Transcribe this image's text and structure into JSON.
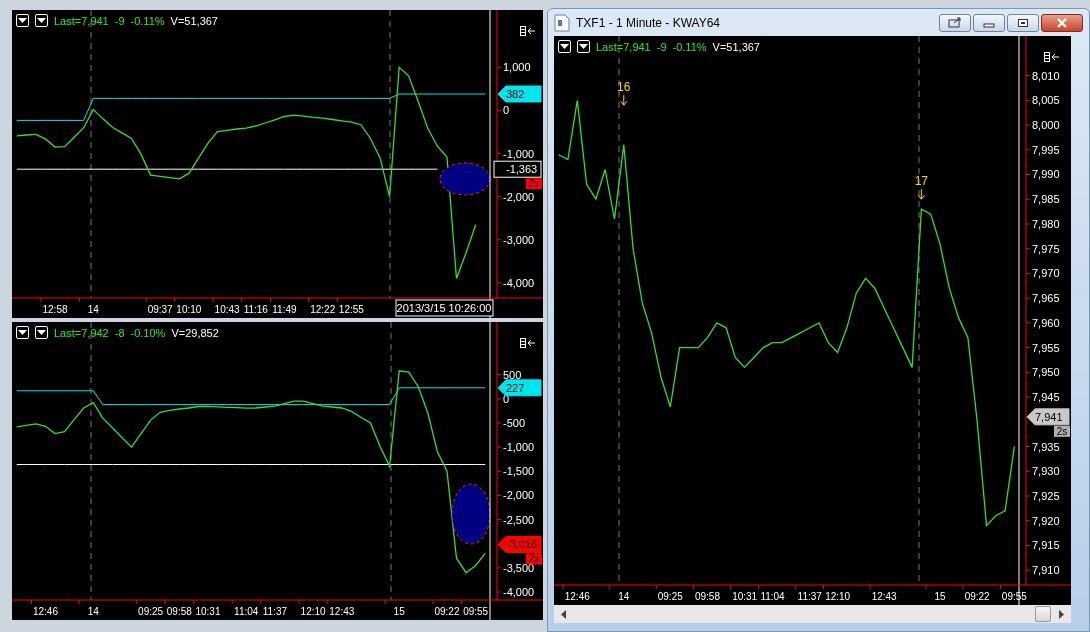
{
  "charts": [
    {
      "quote": {
        "last": "Last=7,941",
        "change": "-9",
        "percent": "-0.11%",
        "volume": "V=51,367"
      },
      "highlight": true,
      "chart_data": {
        "type": "line",
        "ylim": [
          -4350,
          2330
        ],
        "categories": [
          null,
          null,
          null,
          null,
          "12:58",
          null,
          null,
          null,
          "14",
          null,
          null,
          null,
          null,
          null,
          null,
          "09:37",
          null,
          null,
          "10:10",
          null,
          null,
          null,
          "10:43",
          null,
          null,
          "11:16",
          null,
          null,
          "11:49",
          null,
          null,
          null,
          "12:22",
          null,
          null,
          "12:55",
          null,
          null,
          null,
          null,
          null,
          null,
          null,
          null,
          null,
          null,
          null,
          null,
          null,
          null
        ],
        "yticks": [
          {
            "value": 1000,
            "label": "1,000"
          },
          0,
          {
            "value": -1000,
            "label": "-1,000"
          },
          {
            "value": -2000,
            "label": "-2,000"
          },
          {
            "value": -3000,
            "label": "-3,000"
          },
          {
            "value": -4000,
            "label": "-4,000"
          }
        ],
        "series": [
          {
            "color": "#00e5ee",
            "values": [
              -230,
              -230,
              -230,
              -230,
              -230,
              -230,
              -230,
              -230,
              280,
              280,
              280,
              280,
              280,
              280,
              280,
              280,
              280,
              280,
              280,
              280,
              280,
              280,
              280,
              280,
              280,
              280,
              280,
              280,
              280,
              280,
              280,
              280,
              280,
              280,
              280,
              280,
              280,
              280,
              280,
              280,
              382,
              382,
              382,
              382,
              382,
              382,
              382,
              382,
              382,
              382
            ]
          },
          {
            "color": "#ffffff",
            "values": [
              -1363,
              -1363,
              -1363,
              -1363,
              -1363,
              -1363,
              -1363,
              -1363,
              -1363,
              -1363,
              -1363,
              -1363,
              -1363,
              -1363,
              -1363,
              -1363,
              -1363,
              -1363,
              -1363,
              -1363,
              -1363,
              -1363,
              -1363,
              -1363,
              -1363,
              -1363,
              -1363,
              -1363,
              -1363,
              -1363,
              -1363,
              -1363,
              -1363,
              -1363,
              -1363,
              -1363,
              -1363,
              -1363,
              -1363,
              -1363,
              -1363,
              -1363,
              -1363,
              -1363,
              -1363,
              null,
              null,
              null,
              null,
              null
            ]
          },
          {
            "color": "#33dd33",
            "values": [
              -590,
              -570,
              -555,
              -660,
              -850,
              -840,
              -620,
              -400,
              20,
              -190,
              -390,
              -520,
              -650,
              -1020,
              -1500,
              -1530,
              -1560,
              -1585,
              -1460,
              -1110,
              -760,
              -490,
              -460,
              -430,
              -410,
              -360,
              -290,
              -220,
              -140,
              -110,
              -130,
              -160,
              -180,
              -210,
              -240,
              -270,
              -330,
              -650,
              -1100,
              -2000,
              1000,
              800,
              200,
              -420,
              -830,
              -1080,
              -3900,
              -3300,
              -2650,
              null
            ]
          }
        ]
      },
      "tags": [
        {
          "kind": "cyan",
          "text": "382"
        },
        {
          "kind": "boxed",
          "text": "-1,363",
          "badge": "2s"
        }
      ],
      "crosshair_time": "2013/3/15 10:26:00"
    },
    {
      "quote": {
        "last": "Last=7,942",
        "change": "-8",
        "percent": "-0.10%",
        "volume": "V=29,852"
      },
      "highlight": true,
      "chart_data": {
        "type": "line",
        "ylim": [
          -4165,
          1590
        ],
        "categories": [
          null,
          null,
          null,
          "12:46",
          null,
          null,
          null,
          null,
          "14",
          null,
          null,
          null,
          null,
          null,
          "09:25",
          null,
          null,
          "09:58",
          null,
          null,
          "10:31",
          null,
          null,
          null,
          "11:04",
          null,
          null,
          "11:37",
          null,
          null,
          null,
          "12:10",
          null,
          null,
          "12:43",
          null,
          null,
          null,
          null,
          null,
          "15",
          null,
          null,
          null,
          null,
          "09:22",
          null,
          null,
          "09:55",
          null
        ],
        "yticks": [
          500,
          0,
          -500,
          {
            "value": -1000,
            "label": "-1,000"
          },
          {
            "value": -1500,
            "label": "-1,500"
          },
          {
            "value": -2000,
            "label": "-2,000"
          },
          {
            "value": -2500,
            "label": "-2,500"
          },
          {
            "value": -3500,
            "label": "-3,500"
          },
          {
            "value": -4000,
            "label": "-4,000"
          }
        ],
        "series": [
          {
            "color": "#00e5ee",
            "values": [
              165,
              165,
              165,
              165,
              165,
              165,
              165,
              165,
              165,
              -120,
              -120,
              -120,
              -120,
              -120,
              -120,
              -120,
              -120,
              -120,
              -120,
              -120,
              -120,
              -120,
              -120,
              -120,
              -120,
              -120,
              -120,
              -120,
              -120,
              -120,
              -120,
              -120,
              -120,
              -120,
              -120,
              -120,
              -120,
              -120,
              -120,
              -120,
              227,
              227,
              227,
              227,
              227,
              227,
              227,
              227,
              227,
              227
            ]
          },
          {
            "color": "#ffffff",
            "values": [
              -1360,
              -1360,
              -1360,
              -1360,
              -1360,
              -1360,
              -1360,
              -1360,
              -1360,
              -1360,
              -1360,
              -1360,
              -1360,
              -1360,
              -1360,
              -1360,
              -1360,
              -1360,
              -1360,
              -1360,
              -1360,
              -1360,
              -1360,
              -1360,
              -1360,
              -1360,
              -1360,
              -1360,
              -1360,
              -1360,
              -1360,
              -1360,
              -1360,
              -1360,
              -1360,
              -1360,
              -1360,
              -1360,
              -1360,
              -1360,
              -1360,
              -1360,
              -1360,
              -1360,
              -1360,
              -1360,
              -1360,
              -1360,
              -1360,
              -1360
            ]
          },
          {
            "color": "#33dd33",
            "values": [
              -580,
              -550,
              -520,
              -570,
              -720,
              -680,
              -430,
              -190,
              -80,
              -400,
              -600,
              -800,
              -1000,
              -720,
              -440,
              -280,
              -240,
              -210,
              -190,
              -160,
              -155,
              -165,
              -175,
              -185,
              -195,
              -190,
              -170,
              -150,
              -100,
              -50,
              -50,
              -100,
              -150,
              -170,
              -190,
              -260,
              -380,
              -500,
              -990,
              -1400,
              580,
              550,
              250,
              -300,
              -1100,
              -1500,
              -3300,
              -3600,
              -3450,
              -3200
            ]
          }
        ]
      },
      "tags": [
        {
          "kind": "cyan",
          "text": "227"
        },
        {
          "kind": "red",
          "text": "-3,016",
          "badge": "2s"
        }
      ]
    },
    {
      "quote": {
        "last": "Last=7,941",
        "change": "-9",
        "percent": "-0.11%",
        "volume": "V=51,367"
      },
      "chart_data": {
        "type": "line",
        "ylim": [
          7907,
          8018
        ],
        "categories": [
          null,
          null,
          "12:46",
          null,
          null,
          null,
          null,
          "14",
          null,
          null,
          null,
          null,
          "09:25",
          null,
          null,
          null,
          "09:58",
          null,
          null,
          null,
          "10:31",
          null,
          null,
          "11:04",
          null,
          null,
          null,
          "11:37",
          null,
          null,
          "12:10",
          null,
          null,
          null,
          null,
          "12:43",
          null,
          null,
          null,
          null,
          null,
          "15",
          null,
          null,
          null,
          "09:22",
          null,
          null,
          null,
          "09:55"
        ],
        "yticks": [
          {
            "value": 8010,
            "label": "8,010"
          },
          {
            "value": 8005,
            "label": "8,005"
          },
          {
            "value": 8000,
            "label": "8,000"
          },
          {
            "value": 7995,
            "label": "7,995"
          },
          {
            "value": 7990,
            "label": "7,990"
          },
          {
            "value": 7985,
            "label": "7,985"
          },
          {
            "value": 7980,
            "label": "7,980"
          },
          {
            "value": 7975,
            "label": "7,975"
          },
          {
            "value": 7970,
            "label": "7,970"
          },
          {
            "value": 7965,
            "label": "7,965"
          },
          {
            "value": 7960,
            "label": "7,960"
          },
          {
            "value": 7955,
            "label": "7,955"
          },
          {
            "value": 7950,
            "label": "7,950"
          },
          {
            "value": 7945,
            "label": "7,945"
          },
          {
            "value": 7935,
            "label": "7,935"
          },
          {
            "value": 7930,
            "label": "7,930"
          },
          {
            "value": 7925,
            "label": "7,925"
          },
          {
            "value": 7920,
            "label": "7,920"
          },
          {
            "value": 7915,
            "label": "7,915"
          },
          {
            "value": 7910,
            "label": "7,910"
          }
        ],
        "series": [
          {
            "color": "#33dd33",
            "values": [
              7994,
              7993,
              8005,
              7988,
              7985,
              7991,
              7981,
              7996,
              7975,
              7964,
              7958,
              7949,
              7943,
              7955,
              7955,
              7955,
              7957,
              7960,
              7959,
              7953,
              7951,
              7953,
              7955,
              7956,
              7956,
              7957,
              7958,
              7959,
              7960,
              7956,
              7954,
              7959,
              7966,
              7969,
              7967,
              7963,
              7959,
              7955,
              7951,
              7983,
              7982,
              7976,
              7967,
              7961,
              7957,
              7940,
              7919,
              7921,
              7922,
              7935
            ]
          }
        ],
        "annotations": [
          "16",
          "17"
        ]
      },
      "tags": [
        {
          "kind": "grey",
          "text": "7,941",
          "badge": "2s"
        }
      ]
    }
  ],
  "window": {
    "title": "TXF1 - 1 Minute - KWAY64"
  }
}
